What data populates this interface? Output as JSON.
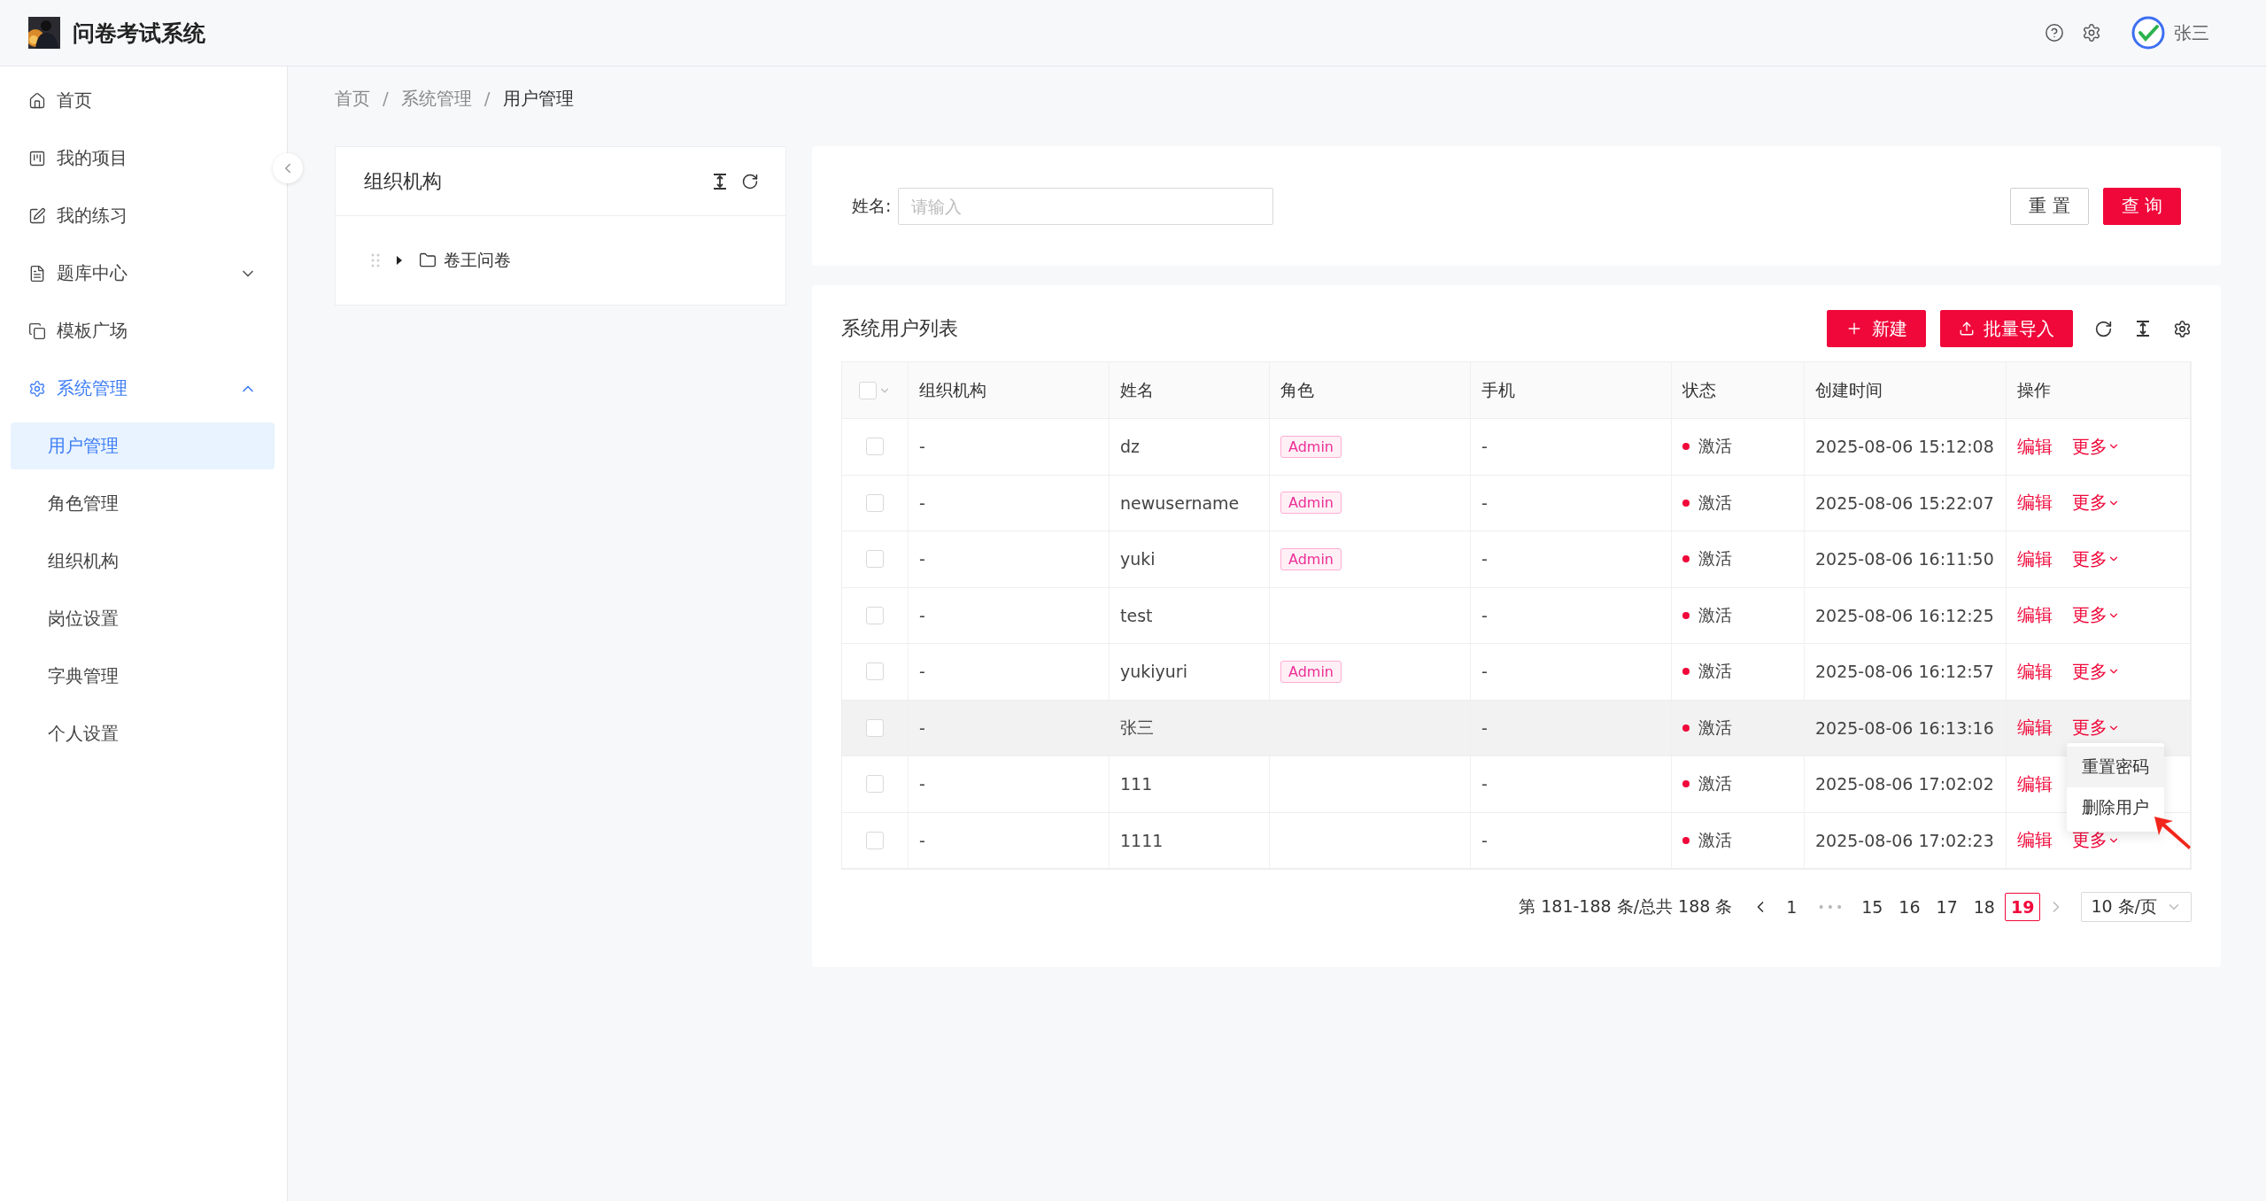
{
  "header": {
    "title": "问卷考试系统",
    "user_name": "张三"
  },
  "sidebar": {
    "items": [
      {
        "label": "首页",
        "selected": false
      },
      {
        "label": "我的项目",
        "selected": false
      },
      {
        "label": "我的练习",
        "selected": false
      },
      {
        "label": "题库中心",
        "selected": false,
        "expanded": false
      },
      {
        "label": "模板广场",
        "selected": false
      },
      {
        "label": "系统管理",
        "selected": false,
        "expanded": true,
        "children": [
          {
            "label": "用户管理",
            "selected": true
          },
          {
            "label": "角色管理",
            "selected": false
          },
          {
            "label": "组织机构",
            "selected": false
          },
          {
            "label": "岗位设置",
            "selected": false
          },
          {
            "label": "字典管理",
            "selected": false
          },
          {
            "label": "个人设置",
            "selected": false
          }
        ]
      }
    ]
  },
  "breadcrumb": {
    "separator": "/",
    "items": [
      "首页",
      "系统管理",
      "用户管理"
    ]
  },
  "org_panel": {
    "title": "组织机构",
    "tree": [
      {
        "label": "卷王问卷",
        "expanded": false
      }
    ]
  },
  "search": {
    "label": "姓名:",
    "placeholder": "请输入",
    "buttons": [
      {
        "label": "重 置",
        "kind": "default"
      },
      {
        "label": "查 询",
        "kind": "primary"
      }
    ]
  },
  "user_table": {
    "title": "系统用户列表",
    "buttons": [
      {
        "label": "新建",
        "kind": "add"
      },
      {
        "label": "批量导入",
        "kind": "import"
      }
    ],
    "select_all": {
      "checked": false
    },
    "columns": [
      "组织机构",
      "姓名",
      "角色",
      "手机",
      "状态",
      "创建时间",
      "操作"
    ],
    "rows": [
      {
        "checked": false,
        "hovered": false,
        "org": "-",
        "name": "dz",
        "role": "Admin",
        "phone": "-",
        "status": "激活",
        "created": "2025-08-06 15:12:08",
        "edit": "编辑",
        "more": "更多"
      },
      {
        "checked": false,
        "hovered": false,
        "org": "-",
        "name": "newusername",
        "role": "Admin",
        "phone": "-",
        "status": "激活",
        "created": "2025-08-06 15:22:07",
        "edit": "编辑",
        "more": "更多"
      },
      {
        "checked": false,
        "hovered": false,
        "org": "-",
        "name": "yuki",
        "role": "Admin",
        "phone": "-",
        "status": "激活",
        "created": "2025-08-06 16:11:50",
        "edit": "编辑",
        "more": "更多"
      },
      {
        "checked": false,
        "hovered": false,
        "org": "-",
        "name": "test",
        "phone": "-",
        "status": "激活",
        "created": "2025-08-06 16:12:25",
        "edit": "编辑",
        "more": "更多"
      },
      {
        "checked": false,
        "hovered": false,
        "org": "-",
        "name": "yukiyuri",
        "role": "Admin",
        "phone": "-",
        "status": "激活",
        "created": "2025-08-06 16:12:57",
        "edit": "编辑",
        "more": "更多"
      },
      {
        "checked": false,
        "hovered": true,
        "org": "-",
        "name": "张三",
        "phone": "-",
        "status": "激活",
        "created": "2025-08-06 16:13:16",
        "edit": "编辑",
        "more": "更多",
        "menu": [
          {
            "label": "重置密码",
            "hovered": true
          },
          {
            "label": "删除用户",
            "hovered": false
          }
        ]
      },
      {
        "checked": false,
        "hovered": false,
        "org": "-",
        "name": "111",
        "phone": "-",
        "status": "激活",
        "created": "2025-08-06 17:02:02",
        "edit": "编辑"
      },
      {
        "checked": false,
        "hovered": false,
        "org": "-",
        "name": "1111",
        "phone": "-",
        "status": "激活",
        "created": "2025-08-06 17:02:23",
        "edit": "编辑",
        "more": "更多"
      }
    ]
  },
  "pagination": {
    "summary": "第 181-188 条/总共 188 条",
    "prev_disabled": false,
    "next_disabled": true,
    "pages": [
      {
        "label": "1",
        "kind": "page",
        "selected": false
      },
      {
        "label": "•••",
        "kind": "ellipsis"
      },
      {
        "label": "15",
        "kind": "page",
        "selected": false
      },
      {
        "label": "16",
        "kind": "page",
        "selected": false
      },
      {
        "label": "17",
        "kind": "page",
        "selected": false
      },
      {
        "label": "18",
        "kind": "page",
        "selected": false
      },
      {
        "label": "19",
        "kind": "page",
        "selected": true
      }
    ],
    "page_size": "10 条/页"
  }
}
